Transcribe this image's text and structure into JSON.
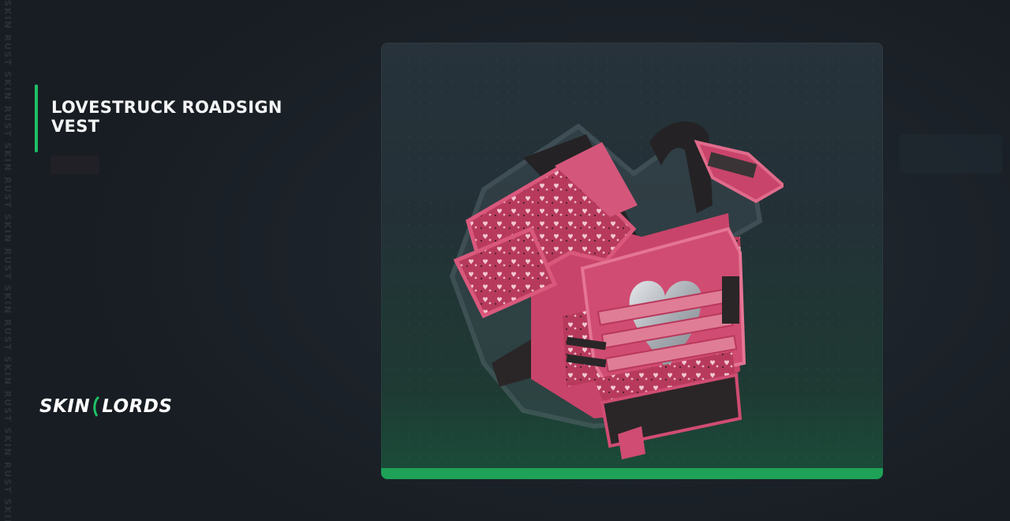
{
  "watermark": {
    "text": "SKIN RUST SKIN RUST SKIN RUST SKIN RUST SKIN RUST SKIN RUST SKIN RUST SKIN RUST"
  },
  "item": {
    "title": "LOVESTRUCK ROADSIGN VEST",
    "image_icon": "armor-vest-icon"
  },
  "brand": {
    "left": "SKIN",
    "right": "LORDS",
    "logo_icon": "skinlords-logo-icon"
  },
  "colors": {
    "accent": "#1fbf66",
    "card_bar": "#1ea257",
    "vest_pink": "#d6456d",
    "vest_pink_light": "#e8768f",
    "heart_silver": "#b9bec4"
  }
}
